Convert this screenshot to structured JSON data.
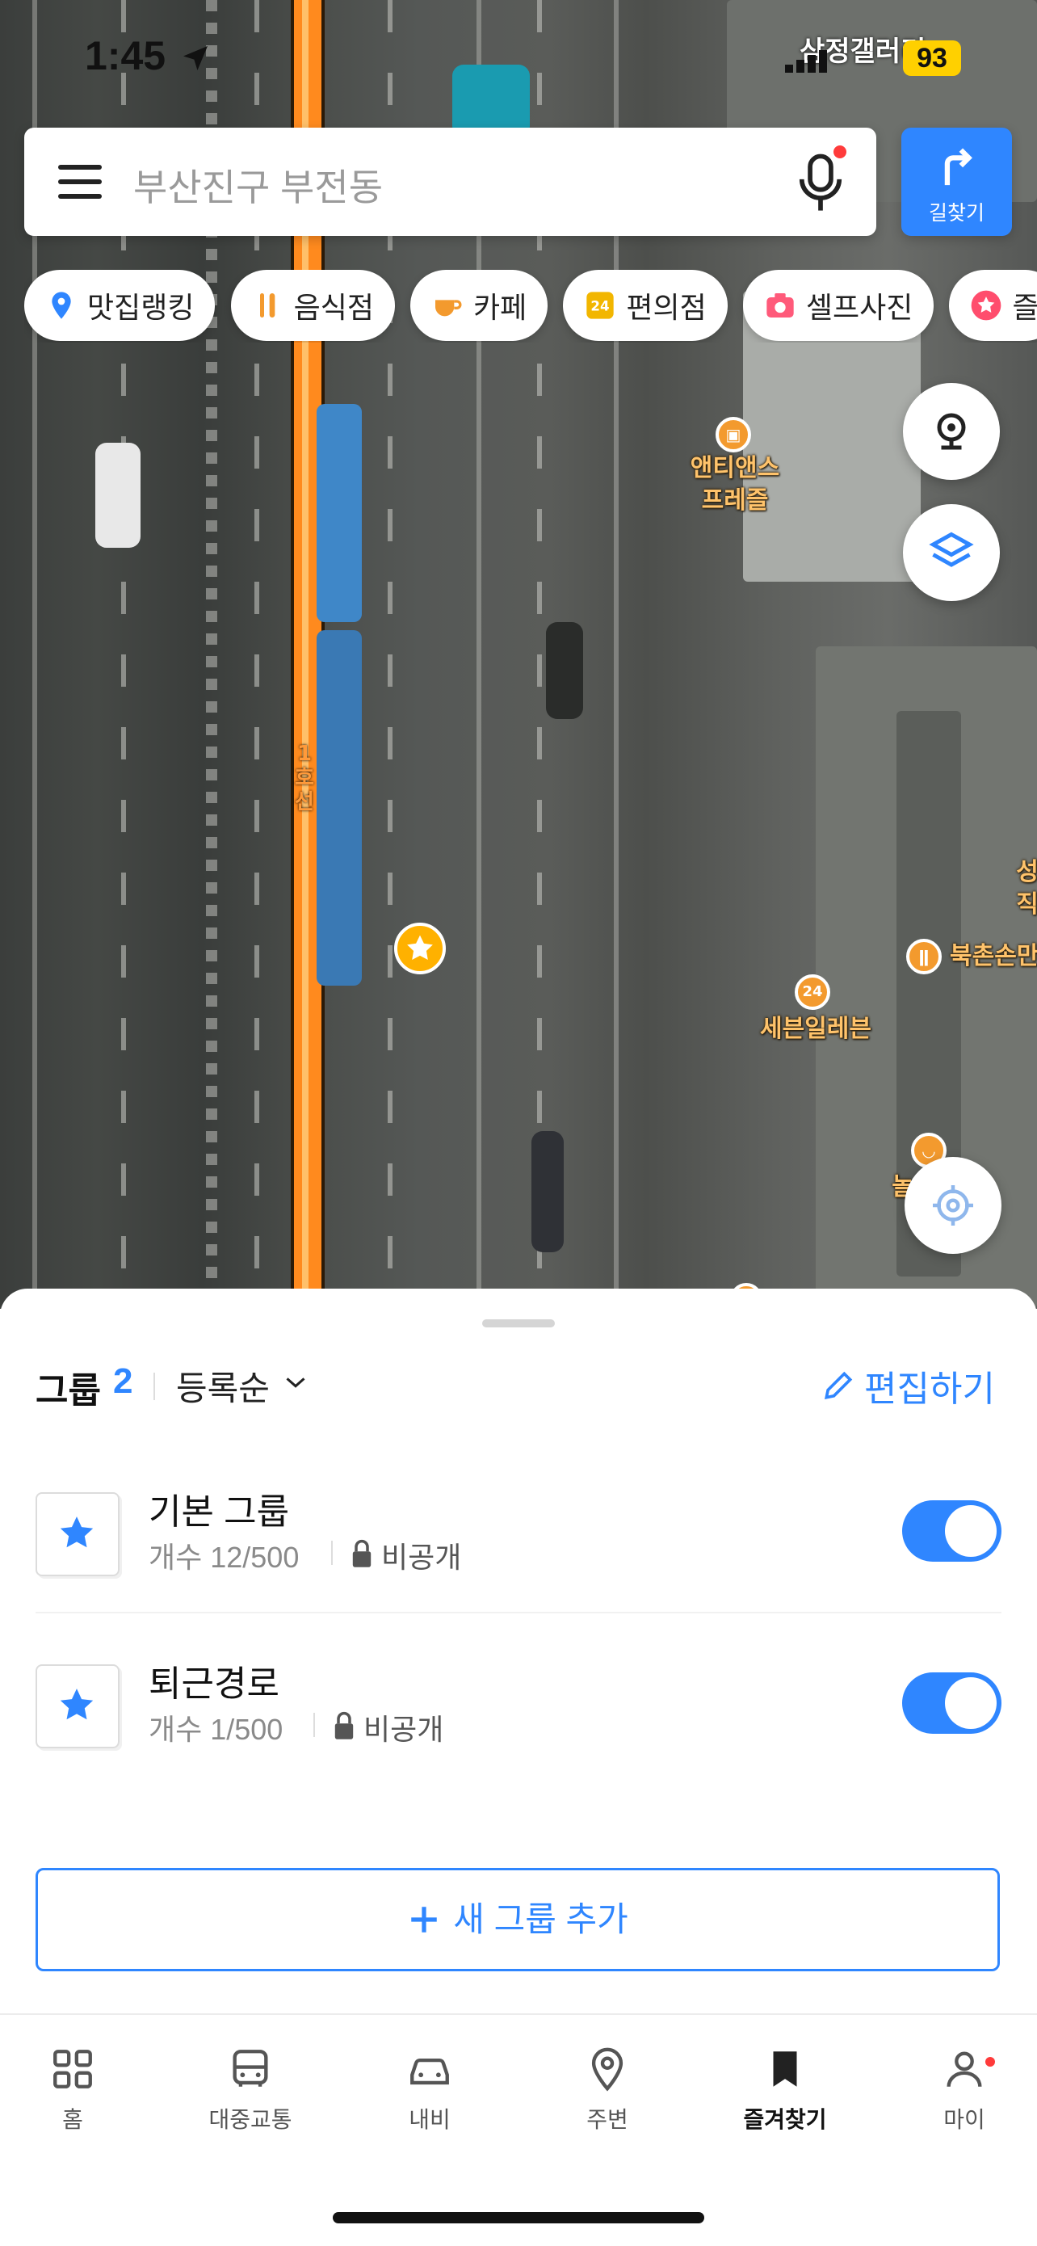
{
  "status_bar": {
    "time": "1:45",
    "battery": "93",
    "place_name": "삼정갤러리"
  },
  "search": {
    "placeholder": "부산진구 부전동",
    "directions_label": "길찾기"
  },
  "categories": [
    {
      "label": "맛집랭킹",
      "icon": "map-pin-icon",
      "color": "#2f86ff"
    },
    {
      "label": "음식점",
      "icon": "fork-knife-icon",
      "color": "#f39a2e"
    },
    {
      "label": "카페",
      "icon": "coffee-cup-icon",
      "color": "#f39a2e"
    },
    {
      "label": "편의점",
      "icon": "store-24-icon",
      "color": "#f2b600"
    },
    {
      "label": "셀프사진",
      "icon": "camera-icon",
      "color": "#ff5a7a"
    },
    {
      "label": "즐",
      "icon": "star-icon",
      "color": "#ff4d6d"
    }
  ],
  "map": {
    "rail_line_label": "1호선",
    "pois": [
      {
        "label_line1": "앤티앤스",
        "label_line2": "프레즐",
        "icon": "bakery-icon"
      },
      {
        "label": "세븐일레븐",
        "icon": "store-24-icon",
        "badge": "24"
      },
      {
        "label": "북촌손만",
        "icon": "restaurant-icon"
      },
      {
        "label": "성",
        "label2": "직",
        "icon": "none"
      },
      {
        "label": "놀",
        "icon": "cafe-icon"
      }
    ]
  },
  "sheet": {
    "groups_label": "그룹",
    "groups_count": "2",
    "sort_label": "등록순",
    "edit_label": "편집하기",
    "groups": [
      {
        "name": "기본 그룹",
        "count": "개수 12/500",
        "privacy": "비공개",
        "enabled": true
      },
      {
        "name": "퇴근경로",
        "count": "개수 1/500",
        "privacy": "비공개",
        "enabled": true
      }
    ],
    "add_group_label": "새 그룹 추가"
  },
  "tabs": [
    {
      "label": "홈",
      "icon": "grid-icon",
      "active": false
    },
    {
      "label": "대중교통",
      "icon": "bus-icon",
      "active": false
    },
    {
      "label": "내비",
      "icon": "car-icon",
      "active": false
    },
    {
      "label": "주변",
      "icon": "location-pin-icon",
      "active": false
    },
    {
      "label": "즐겨찾기",
      "icon": "bookmark-icon",
      "active": true
    },
    {
      "label": "마이",
      "icon": "person-icon",
      "active": false
    }
  ],
  "colors": {
    "accent": "#2f86ff",
    "rail": "#ff8a1e",
    "poi": "#f39a2e"
  }
}
